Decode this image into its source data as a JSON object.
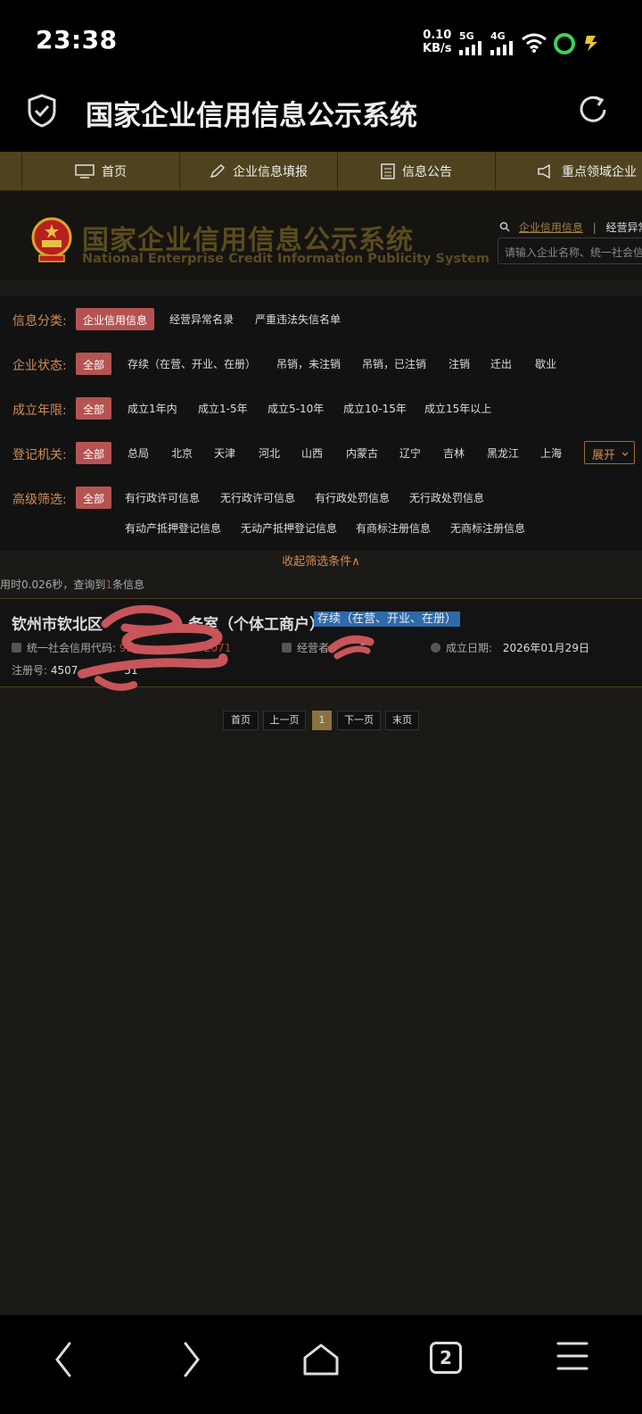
{
  "status_bar": {
    "time": "23:38",
    "net_speed_value": "0.10",
    "net_speed_unit": "KB/s",
    "signal1": "5G",
    "signal2": "4G"
  },
  "browser": {
    "title": "国家企业信用信息公示系统",
    "tab_count": "2"
  },
  "nav": {
    "items": [
      {
        "label": "首页"
      },
      {
        "label": "企业信息填报"
      },
      {
        "label": "信息公告"
      },
      {
        "label": "重点领域企业"
      }
    ]
  },
  "header": {
    "logo_cn": "国家企业信用信息公示系统",
    "logo_en": "National Enterprise Credit Information Publicity System",
    "link_credit": "企业信用信息",
    "link_separator": "|",
    "link_abnormal": "经营异常",
    "search_placeholder": "请输入企业名称、统一社会信用代码"
  },
  "filters": {
    "info_category": {
      "label": "信息分类:",
      "selected": "企业信用信息",
      "options": [
        "经营异常名录",
        "严重违法失信名单"
      ]
    },
    "status": {
      "label": "企业状态:",
      "selected": "全部",
      "options": [
        "存续（在营、开业、在册）",
        "吊销，未注销",
        "吊销，已注销",
        "注销",
        "迁出",
        "歇业"
      ]
    },
    "years": {
      "label": "成立年限:",
      "selected": "全部",
      "options": [
        "成立1年内",
        "成立1-5年",
        "成立5-10年",
        "成立10-15年",
        "成立15年以上"
      ]
    },
    "authority": {
      "label": "登记机关:",
      "selected": "全部",
      "options": [
        "总局",
        "北京",
        "天津",
        "河北",
        "山西",
        "内蒙古",
        "辽宁",
        "吉林",
        "黑龙江",
        "上海"
      ],
      "expand_label": "展开"
    },
    "advanced": {
      "label": "高级筛选:",
      "selected": "全部",
      "options_row1": [
        "有行政许可信息",
        "无行政许可信息",
        "有行政处罚信息",
        "无行政处罚信息"
      ],
      "options_row2": [
        "有动产抵押登记信息",
        "无动产抵押登记信息",
        "有商标注册信息",
        "无商标注册信息"
      ]
    },
    "collapse_label": "收起筛选条件∧"
  },
  "summary": {
    "prefix": "用时0.026秒，查询到",
    "count": "1",
    "suffix": "条信息"
  },
  "result": {
    "name_start": "钦州市钦北区",
    "name_end": "务室（个体工商户）",
    "status_badge": "存续（在营、开业、在册）",
    "credit_code_label": "统一社会信用代码:",
    "credit_code_start": "924",
    "credit_code_end": "2071",
    "operator_label": "经营者:",
    "operator_end": "二",
    "established_label": "成立日期:",
    "established_value": "2026年01月29日",
    "reg_label": "注册号:",
    "reg_value_start": "4507",
    "reg_value_end": "51"
  },
  "pagination": {
    "first": "首页",
    "prev": "上一页",
    "current": "1",
    "next": "下一页",
    "last": "末页"
  },
  "colors": {
    "accent": "#d48a55",
    "selected_tag": "#b55352",
    "nav_bar": "#4e431e",
    "status_badge": "#2e6aa9",
    "redaction": "#c8555a"
  },
  "bottom_nav_icons": [
    "back-icon",
    "forward-icon",
    "home-icon",
    "tabs-icon",
    "menu-icon"
  ]
}
